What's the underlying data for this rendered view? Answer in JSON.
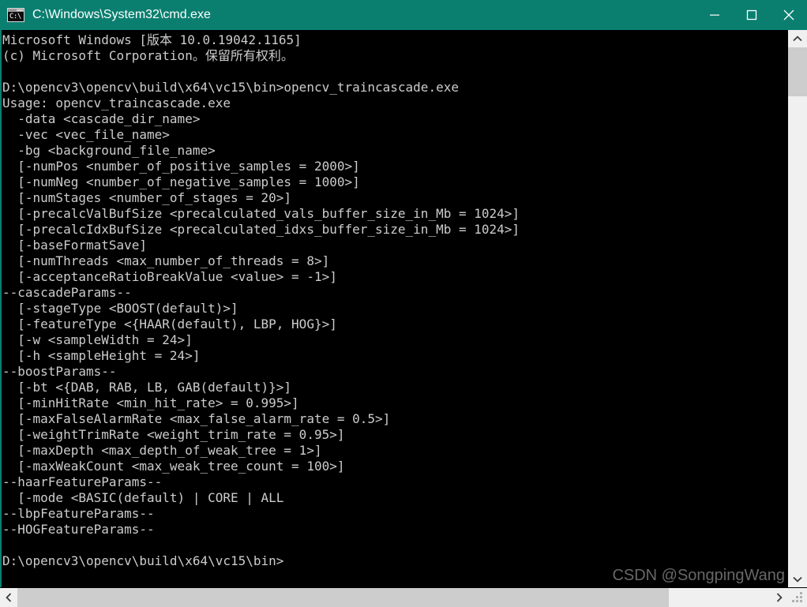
{
  "window": {
    "title": "C:\\Windows\\System32\\cmd.exe",
    "icon": "cmd-icon",
    "titlebar_color": "#0a7f70",
    "background_color": "#000000",
    "text_color": "#cccccc",
    "controls": {
      "minimize_label": "Minimize",
      "maximize_label": "Maximize",
      "close_label": "Close"
    }
  },
  "console": {
    "lines": [
      "Microsoft Windows [版本 10.0.19042.1165]",
      "(c) Microsoft Corporation。保留所有权利。",
      "",
      "D:\\opencv3\\opencv\\build\\x64\\vc15\\bin>opencv_traincascade.exe",
      "Usage: opencv_traincascade.exe",
      "  -data <cascade_dir_name>",
      "  -vec <vec_file_name>",
      "  -bg <background_file_name>",
      "  [-numPos <number_of_positive_samples = 2000>]",
      "  [-numNeg <number_of_negative_samples = 1000>]",
      "  [-numStages <number_of_stages = 20>]",
      "  [-precalcValBufSize <precalculated_vals_buffer_size_in_Mb = 1024>]",
      "  [-precalcIdxBufSize <precalculated_idxs_buffer_size_in_Mb = 1024>]",
      "  [-baseFormatSave]",
      "  [-numThreads <max_number_of_threads = 8>]",
      "  [-acceptanceRatioBreakValue <value> = -1>]",
      "--cascadeParams--",
      "  [-stageType <BOOST(default)>]",
      "  [-featureType <{HAAR(default), LBP, HOG}>]",
      "  [-w <sampleWidth = 24>]",
      "  [-h <sampleHeight = 24>]",
      "--boostParams--",
      "  [-bt <{DAB, RAB, LB, GAB(default)}>]",
      "  [-minHitRate <min_hit_rate> = 0.995>]",
      "  [-maxFalseAlarmRate <max_false_alarm_rate = 0.5>]",
      "  [-weightTrimRate <weight_trim_rate = 0.95>]",
      "  [-maxDepth <max_depth_of_weak_tree = 1>]",
      "  [-maxWeakCount <max_weak_tree_count = 100>]",
      "--haarFeatureParams--",
      "  [-mode <BASIC(default) | CORE | ALL",
      "--lbpFeatureParams--",
      "--HOGFeatureParams--",
      "",
      "D:\\opencv3\\opencv\\build\\x64\\vc15\\bin>"
    ]
  },
  "scrollbars": {
    "vertical": {
      "up_arrow": "chevron-up-icon",
      "down_arrow": "chevron-down-icon",
      "thumb_color": "#cdcdcd",
      "track_color": "#f0f0f0"
    },
    "horizontal": {
      "left_arrow": "chevron-left-icon",
      "right_arrow": "chevron-right-icon",
      "thumb_color": "#cdcdcd",
      "track_color": "#f0f0f0"
    }
  },
  "watermark": {
    "text": "CSDN @SongpingWang"
  }
}
